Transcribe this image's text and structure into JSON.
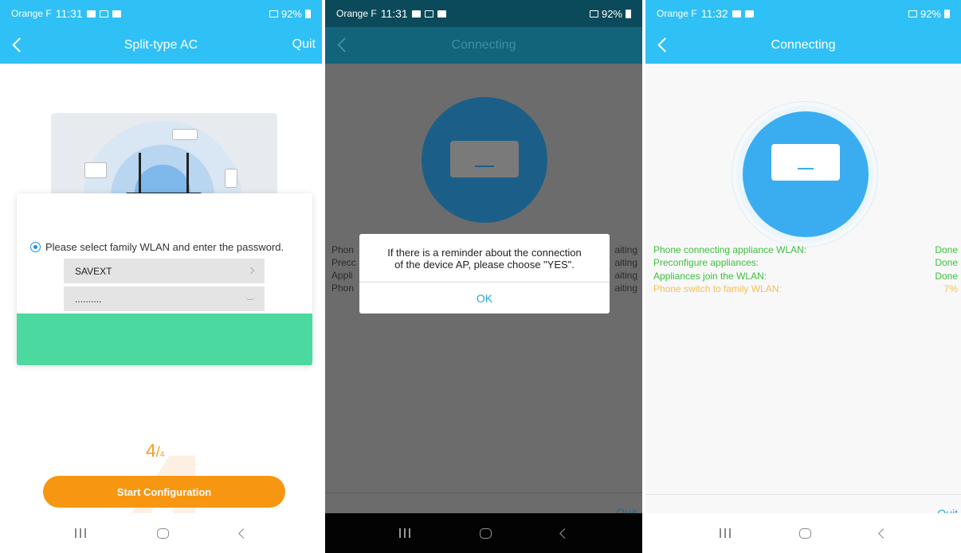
{
  "colors": {
    "accent": "#2fc0f6",
    "orange": "#f79611",
    "green_status": "#3cbf3c",
    "pending_status": "#f3bf55",
    "card_green": "#4bd9a0"
  },
  "screen1": {
    "status_bar": {
      "carrier": "Orange F",
      "time": "11:31",
      "battery": "92%"
    },
    "header": {
      "title": "Split-type AC",
      "quit": "Quit"
    },
    "instruction": "Please select family WLAN and enter the password.",
    "wifi_ssid": "SAVEXT",
    "wifi_password": "..........",
    "step_current": "4",
    "step_slash": "/",
    "step_total": "4",
    "start_button": "Start Configuration"
  },
  "screen2": {
    "status_bar": {
      "carrier": "Orange F",
      "time": "11:31",
      "battery": "92%"
    },
    "header": {
      "title": "Connecting"
    },
    "background_lines_left": [
      "Phon",
      "Precc",
      "Appli",
      "Phon"
    ],
    "background_lines_right": [
      "aiting",
      "aiting",
      "aiting",
      "aiting"
    ],
    "dialog": {
      "message_line1": "If there is a reminder about the connection",
      "message_line2": "of the device AP, please choose \"YES\".",
      "ok": "OK"
    },
    "quit": "Quit"
  },
  "screen3": {
    "status_bar": {
      "carrier": "Orange F",
      "time": "11:32",
      "battery": "92%"
    },
    "header": {
      "title": "Connecting"
    },
    "steps": [
      {
        "label": "Phone connecting appliance WLAN:",
        "status": "Done"
      },
      {
        "label": "Preconfigure appliances:",
        "status": "Done"
      },
      {
        "label": "Appliances join the WLAN:",
        "status": "Done"
      },
      {
        "label": "Phone switch to family WLAN:",
        "status": "7%"
      }
    ],
    "quit": "Quit"
  }
}
